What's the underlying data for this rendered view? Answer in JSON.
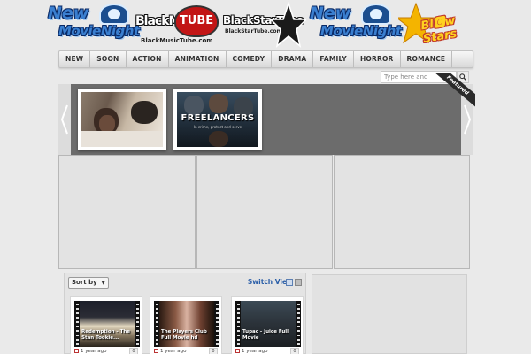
{
  "header": {
    "movienight_new": "New",
    "movienight_name": "MovieNight",
    "bmt_black": "BlackMusic",
    "bmt_tube": "TUBE",
    "bmt_url": "BlackMusicTube.com",
    "bst_name": "BlackStarTube",
    "bst_url": "BlackStarTube.com",
    "bs_name": "Bl🅾w Stars"
  },
  "nav": {
    "items": [
      "NEW",
      "SOON",
      "ACTION",
      "ANIMATION",
      "COMEDY",
      "DRAMA",
      "FAMILY",
      "HORROR",
      "ROMANCE"
    ]
  },
  "search": {
    "placeholder": "Type here and"
  },
  "slider": {
    "ribbon": "Featured",
    "slide2_title": "FREELANCERS",
    "slide2_sub": "In crime, protect and serve"
  },
  "content": {
    "sort_label": "Sort by",
    "switch_view": "Switch View",
    "videos": [
      {
        "title": "Redemption - The Stan Tookie...",
        "age": "1 year ago",
        "count": "0"
      },
      {
        "title": "The Players Club Full Movie hd",
        "age": "1 year ago",
        "count": "0"
      },
      {
        "title": "Tupac - Juice Full Movie",
        "age": "1 year ago",
        "count": "0"
      }
    ]
  },
  "colors": {
    "accent_link": "#2a5ea8",
    "slider_bg": "#6c6c6c",
    "page_bg": "#eaeaea"
  }
}
